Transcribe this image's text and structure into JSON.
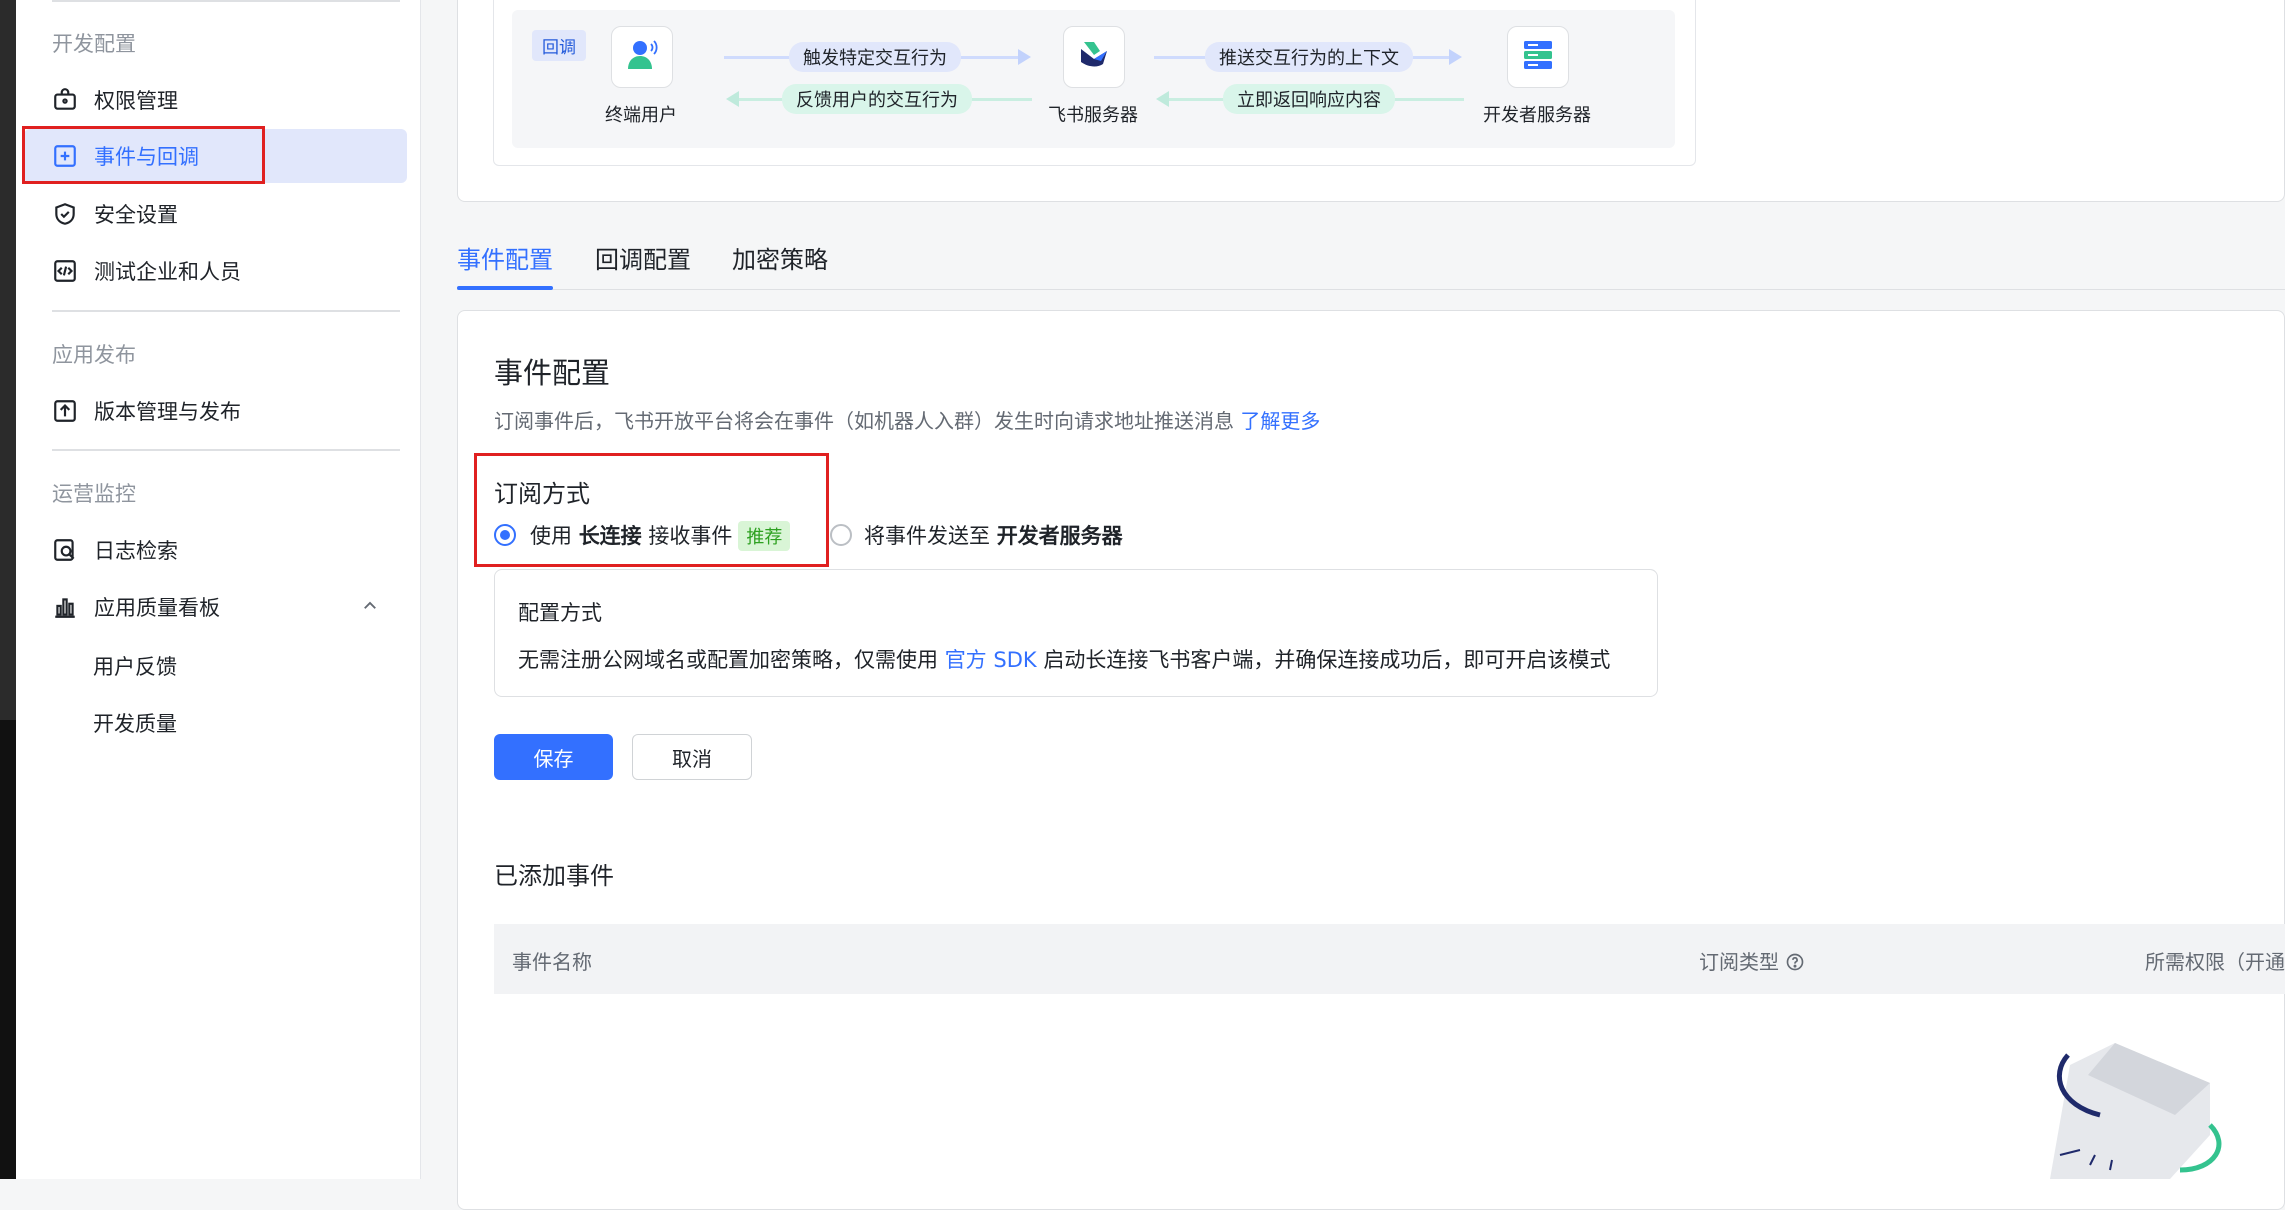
{
  "sidebar": {
    "sections": [
      {
        "title": "开发配置"
      },
      {
        "title": "应用发布"
      },
      {
        "title": "运营监控"
      }
    ],
    "items": {
      "permissions": "权限管理",
      "events_callbacks": "事件与回调",
      "security": "安全设置",
      "test_org": "测试企业和人员",
      "version_release": "版本管理与发布",
      "log_search": "日志检索",
      "quality_board": "应用质量看板",
      "user_feedback": "用户反馈",
      "dev_quality": "开发质量"
    }
  },
  "flow": {
    "tag": "回调",
    "nodes": {
      "end_user": "终端用户",
      "feishu_server": "飞书服务器",
      "dev_server": "开发者服务器"
    },
    "arrows": {
      "trigger": "触发特定交互行为",
      "feedback": "反馈用户的交互行为",
      "push_context": "推送交互行为的上下文",
      "return_response": "立即返回响应内容"
    }
  },
  "tabs": [
    "事件配置",
    "回调配置",
    "加密策略"
  ],
  "event_config": {
    "title": "事件配置",
    "description": "订阅事件后，飞书开放平台将会在事件（如机器人入群）发生时向请求地址推送消息",
    "learn_more": "了解更多",
    "subscription_method_label": "订阅方式",
    "option1": {
      "prefix": "使用",
      "bold": "长连接",
      "suffix": "接收事件",
      "badge": "推荐"
    },
    "option2": {
      "prefix": "将事件发送至",
      "bold": "开发者服务器"
    },
    "method_box": {
      "title": "配置方式",
      "text_before": "无需注册公网域名或配置加密策略，仅需使用",
      "link": "官方 SDK",
      "text_after": "启动长连接飞书客户端，并确保连接成功后，即可开启该模式"
    },
    "save": "保存",
    "cancel": "取消",
    "added_events_title": "已添加事件",
    "table_headers": {
      "name": "事件名称",
      "type": "订阅类型",
      "permission": "所需权限（开通"
    }
  },
  "colors": {
    "accent": "#3370ff",
    "highlight_red": "#e02020",
    "badge_green": "#2ea121"
  }
}
